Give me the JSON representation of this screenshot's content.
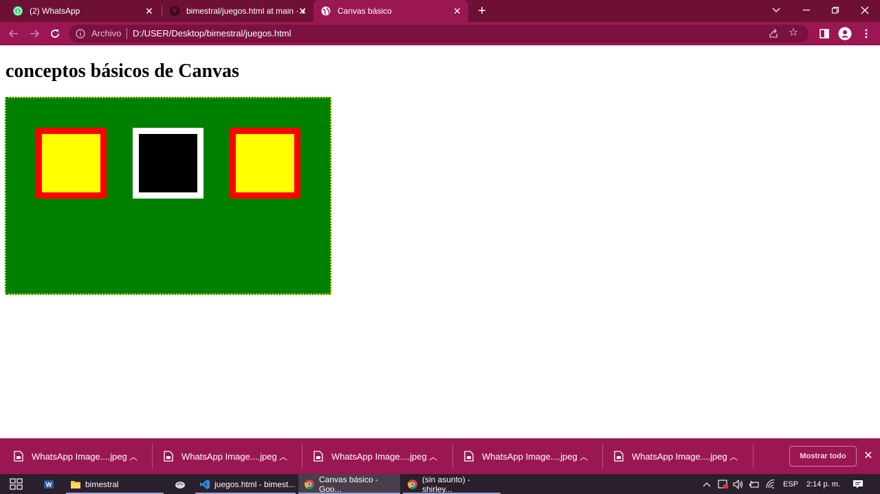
{
  "browser": {
    "tabs": [
      {
        "title": "(2) WhatsApp",
        "favicon": "whatsapp-icon",
        "active": false
      },
      {
        "title": "bimestral/juegos.html at main · v",
        "favicon": "github-icon",
        "active": false
      },
      {
        "title": "Canvas básico",
        "favicon": "globe-icon",
        "active": true
      }
    ],
    "address_bar": {
      "security_chip": "Archivo",
      "url": "D:/USER/Desktop/bimestral/juegos.html"
    }
  },
  "page": {
    "heading": "conceptos básicos de Canvas",
    "canvas": {
      "background": "#008000",
      "border_color": "#d4d400",
      "squares": [
        {
          "fill": "#ffff00",
          "stroke": "#ff0000"
        },
        {
          "fill": "#000000",
          "stroke": "#ffffff"
        },
        {
          "fill": "#ffff00",
          "stroke": "#ff0000"
        }
      ]
    }
  },
  "downloads": {
    "items": [
      {
        "name": "WhatsApp Image....jpeg"
      },
      {
        "name": "WhatsApp Image....jpeg"
      },
      {
        "name": "WhatsApp Image....jpeg"
      },
      {
        "name": "WhatsApp Image....jpeg"
      },
      {
        "name": "WhatsApp Image....jpeg"
      }
    ],
    "show_all_label": "Mostrar todo"
  },
  "taskbar": {
    "apps": [
      {
        "label": "bimestral",
        "icon": "folder-icon"
      },
      {
        "label": "juegos.html - bimest...",
        "icon": "vscode-icon"
      },
      {
        "label": "Canvas básico - Goo...",
        "icon": "chrome-icon"
      },
      {
        "label": "(sin asunto) - shirley...",
        "icon": "chrome-icon"
      }
    ],
    "tray": {
      "language": "ESP",
      "time": "2:14 p. m."
    }
  },
  "colors": {
    "tab_strip": "#6e1036",
    "toolbar": "#9b1753",
    "taskbar": "#2a1f2c"
  }
}
